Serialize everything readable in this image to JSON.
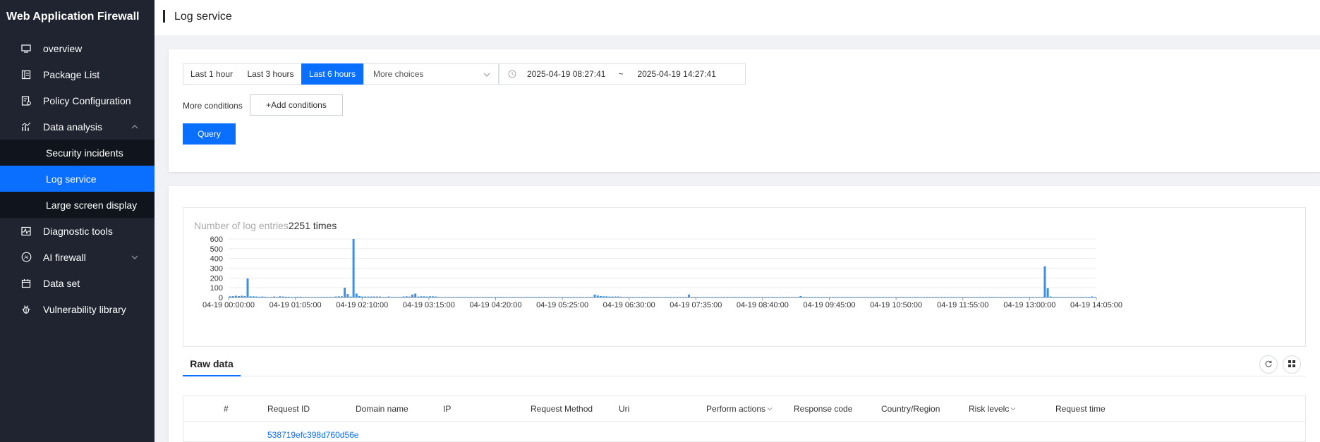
{
  "app": {
    "title": "Web Application Firewall"
  },
  "sidebar": {
    "items": [
      {
        "label": "overview",
        "icon": "monitor-icon"
      },
      {
        "label": "Package List",
        "icon": "package-icon"
      },
      {
        "label": "Policy Configuration",
        "icon": "policy-icon"
      },
      {
        "label": "Data analysis",
        "icon": "chart-icon",
        "expanded": true,
        "children": [
          {
            "label": "Security incidents"
          },
          {
            "label": "Log service",
            "active": true
          },
          {
            "label": "Large screen display"
          }
        ]
      },
      {
        "label": "Diagnostic tools",
        "icon": "diagnostic-icon"
      },
      {
        "label": "AI firewall",
        "icon": "ai-icon",
        "expandable": true
      },
      {
        "label": "Data set",
        "icon": "calendar-icon"
      },
      {
        "label": "Vulnerability library",
        "icon": "bug-icon"
      }
    ]
  },
  "header": {
    "title": "Log service"
  },
  "filters": {
    "ranges": [
      "Last 1 hour",
      "Last 3 hours",
      "Last 6 hours"
    ],
    "active_range": "Last 6 hours",
    "more_choices": "More choices",
    "start_time": "2025-04-19 08:27:41",
    "separator": "~",
    "end_time": "2025-04-19 14:27:41",
    "more_conditions_label": "More conditions",
    "add_conditions_label": "+Add conditions",
    "query_label": "Query"
  },
  "summary": {
    "label": "Number of log entries",
    "value": "2251 times"
  },
  "chart_data": {
    "type": "bar",
    "ylim": [
      0,
      600
    ],
    "y_ticks": [
      0,
      100,
      200,
      300,
      400,
      500,
      600
    ],
    "x_tick_labels": [
      "04-19 00:00:00",
      "04-19 01:05:00",
      "04-19 02:10:00",
      "04-19 03:15:00",
      "04-19 04:20:00",
      "04-19 05:25:00",
      "04-19 06:30:00",
      "04-19 07:35:00",
      "04-19 08:40:00",
      "04-19 09:45:00",
      "04-19 10:50:00",
      "04-19 11:55:00",
      "04-19 13:00:00",
      "04-19 14:05:00"
    ],
    "grid": true,
    "bar_color": "#3a8ee6",
    "values": [
      12,
      14,
      18,
      14,
      18,
      15,
      195,
      12,
      12,
      10,
      8,
      10,
      8,
      6,
      6,
      10,
      6,
      12,
      10,
      8,
      8,
      6,
      6,
      8,
      8,
      6,
      6,
      6,
      6,
      6,
      6,
      6,
      6,
      6,
      6,
      6,
      10,
      12,
      12,
      100,
      35,
      10,
      600,
      40,
      15,
      10,
      10,
      10,
      10,
      10,
      10,
      10,
      6,
      6,
      10,
      6,
      6,
      6,
      6,
      10,
      12,
      10,
      30,
      40,
      10,
      12,
      12,
      10,
      12,
      12,
      10,
      6,
      6,
      6,
      6,
      6,
      6,
      6,
      6,
      6,
      6,
      6,
      6,
      6,
      6,
      6,
      6,
      6,
      6,
      6,
      6,
      6,
      6,
      6,
      6,
      6,
      6,
      6,
      6,
      6,
      6,
      6,
      6,
      6,
      6,
      6,
      6,
      6,
      6,
      6,
      6,
      6,
      6,
      6,
      6,
      6,
      6,
      6,
      6,
      6,
      6,
      6,
      6,
      6,
      30,
      20,
      15,
      12,
      12,
      10,
      10,
      10,
      10,
      8,
      6,
      6,
      6,
      6,
      6,
      6,
      6,
      6,
      6,
      6,
      6,
      6,
      6,
      6,
      6,
      6,
      6,
      6,
      6,
      6,
      6,
      6,
      30,
      6,
      6,
      6,
      6,
      6,
      6,
      6,
      6,
      6,
      6,
      6,
      6,
      6,
      6,
      6,
      6,
      6,
      6,
      6,
      6,
      6,
      6,
      6,
      6,
      6,
      6,
      6,
      6,
      6,
      6,
      6,
      6,
      6,
      6,
      6,
      6,
      6,
      15,
      6,
      6,
      6,
      6,
      6,
      6,
      6,
      6,
      6,
      6,
      6,
      6,
      6,
      6,
      6,
      6,
      6,
      6,
      6,
      6,
      6,
      6,
      6,
      6,
      6,
      6,
      6,
      6,
      6,
      6,
      6,
      6,
      6,
      6,
      6,
      6,
      6,
      6,
      6,
      6,
      6,
      6,
      6,
      6,
      6,
      6,
      6,
      6,
      6,
      6,
      6,
      6,
      6,
      6,
      6,
      6,
      6,
      6,
      6,
      6,
      6,
      6,
      6,
      6,
      6,
      6,
      6,
      6,
      6,
      6,
      6,
      6,
      6,
      6,
      6,
      6,
      6,
      6,
      6,
      6,
      6,
      6,
      320,
      95,
      10,
      6,
      6,
      6,
      6,
      6,
      6,
      6,
      6,
      6,
      6,
      6,
      6,
      6,
      10,
      6
    ]
  },
  "tabs": {
    "raw_data": "Raw data"
  },
  "table": {
    "columns": [
      "#",
      "Request ID",
      "Domain name",
      "IP",
      "Request Method",
      "Uri",
      "Perform actions",
      "Response code",
      "Country/Region",
      "Risk levelc",
      "Request time"
    ],
    "sortable": [
      "Perform actions",
      "Risk levelc"
    ],
    "first_row_request_id": "538719efc398d760d56e"
  }
}
